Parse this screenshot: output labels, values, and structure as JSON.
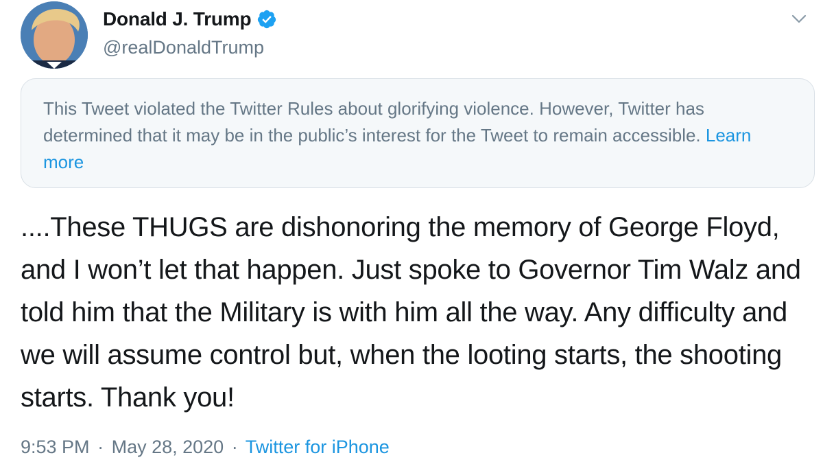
{
  "author": {
    "display_name": "Donald J. Trump",
    "handle": "@realDonaldTrump",
    "verified": true,
    "avatar_icon": "user-avatar"
  },
  "menu_icon": "chevron-down-icon",
  "notice": {
    "text": "This Tweet violated the Twitter Rules about glorifying violence. However, Twitter has determined that it may be in the public’s interest for the Tweet to remain accessible.",
    "link_label": "Learn more"
  },
  "tweet": {
    "text": "....These THUGS are dishonoring the memory of George Floyd, and I won’t let that happen. Just spoke to Governor Tim Walz and told him that the Military is with him all the way. Any difficulty and we will assume control but, when the looting starts, the shooting starts. Thank you!"
  },
  "meta": {
    "time": "9:53 PM",
    "separator": "·",
    "date": "May 28, 2020",
    "source": "Twitter for iPhone"
  },
  "colors": {
    "link": "#1b95e0",
    "verified_badge": "#1da1f2",
    "secondary_text": "#657786",
    "notice_background": "#f5f8fa"
  }
}
